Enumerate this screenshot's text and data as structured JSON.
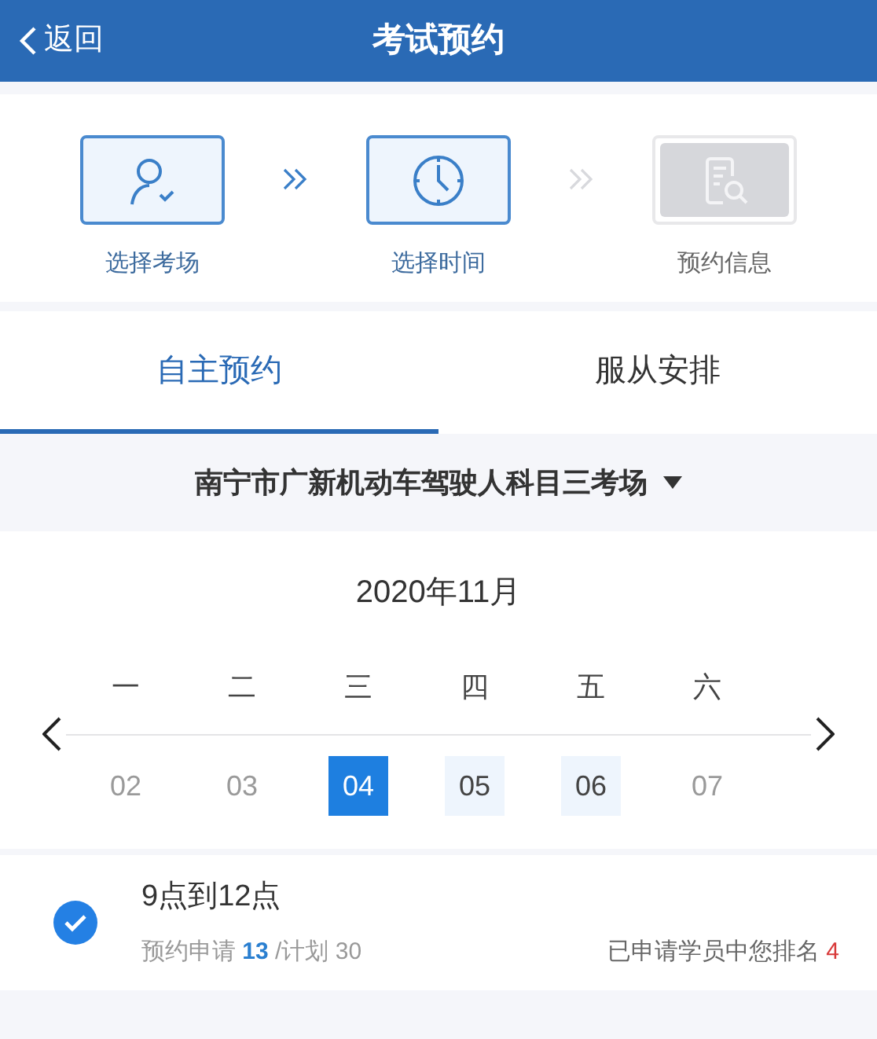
{
  "header": {
    "back": "返回",
    "title": "考试预约"
  },
  "steps": [
    {
      "label": "选择考场",
      "active": true,
      "kind": "person"
    },
    {
      "label": "选择时间",
      "active": true,
      "kind": "clock"
    },
    {
      "label": "预约信息",
      "active": false,
      "kind": "document"
    }
  ],
  "tabs": [
    {
      "label": "自主预约",
      "selected": true
    },
    {
      "label": "服从安排",
      "selected": false
    }
  ],
  "venue": "南宁市广新机动车驾驶人科目三考场",
  "calendar": {
    "month": "2020年11月",
    "days": [
      {
        "weekday": "一",
        "date": "02",
        "kind": "unavailable"
      },
      {
        "weekday": "二",
        "date": "03",
        "kind": "unavailable"
      },
      {
        "weekday": "三",
        "date": "04",
        "kind": "selected"
      },
      {
        "weekday": "四",
        "date": "05",
        "kind": "available"
      },
      {
        "weekday": "五",
        "date": "06",
        "kind": "available"
      },
      {
        "weekday": "六",
        "date": "07",
        "kind": "unavailable"
      }
    ]
  },
  "slots": [
    {
      "time": "9点到12点",
      "checked": true,
      "applied_label": "预约申请",
      "applied": "13",
      "plan": "/计划 30",
      "rank_label": "已申请学员中您排名",
      "rank": "4"
    }
  ]
}
